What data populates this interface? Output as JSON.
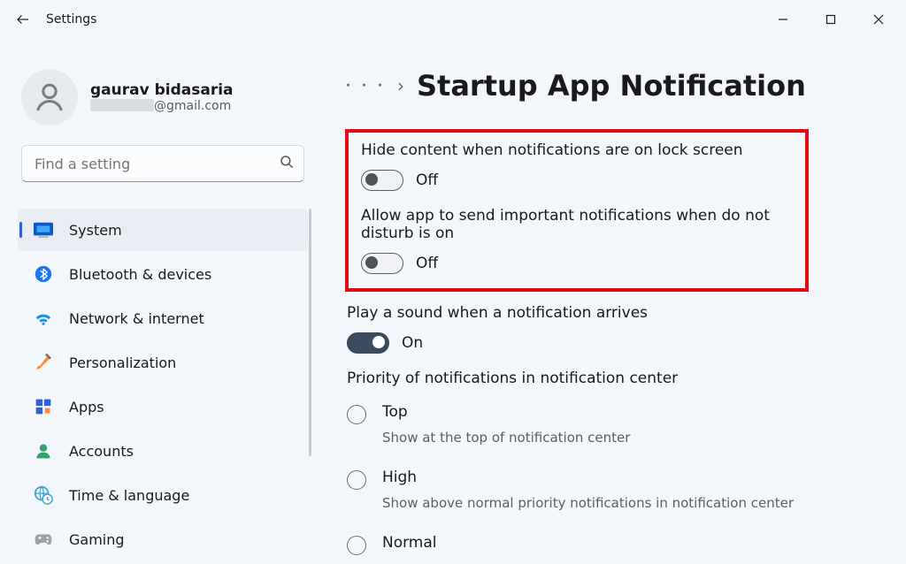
{
  "window": {
    "title": "Settings"
  },
  "profile": {
    "name": "gaurav bidasaria",
    "email_suffix": "@gmail.com"
  },
  "search": {
    "placeholder": "Find a setting"
  },
  "nav": [
    {
      "key": "system",
      "label": "System",
      "active": true
    },
    {
      "key": "bluetooth",
      "label": "Bluetooth & devices"
    },
    {
      "key": "network",
      "label": "Network & internet"
    },
    {
      "key": "personalization",
      "label": "Personalization"
    },
    {
      "key": "apps",
      "label": "Apps"
    },
    {
      "key": "accounts",
      "label": "Accounts"
    },
    {
      "key": "time",
      "label": "Time & language"
    },
    {
      "key": "gaming",
      "label": "Gaming"
    }
  ],
  "header": {
    "dots": "· · ·",
    "sep": "›",
    "title": "Startup App Notification"
  },
  "settings": {
    "hide_content": {
      "label": "Hide content when notifications are on lock screen",
      "state": "Off"
    },
    "allow_important": {
      "label": "Allow app to send important notifications when do not disturb is on",
      "state": "Off"
    },
    "play_sound": {
      "label": "Play a sound when a notification arrives",
      "state": "On"
    }
  },
  "priority": {
    "title": "Priority of notifications in notification center",
    "options": [
      {
        "key": "top",
        "label": "Top",
        "desc": "Show at the top of notification center"
      },
      {
        "key": "high",
        "label": "High",
        "desc": "Show above normal priority notifications in notification center"
      },
      {
        "key": "normal",
        "label": "Normal",
        "desc": ""
      }
    ]
  }
}
